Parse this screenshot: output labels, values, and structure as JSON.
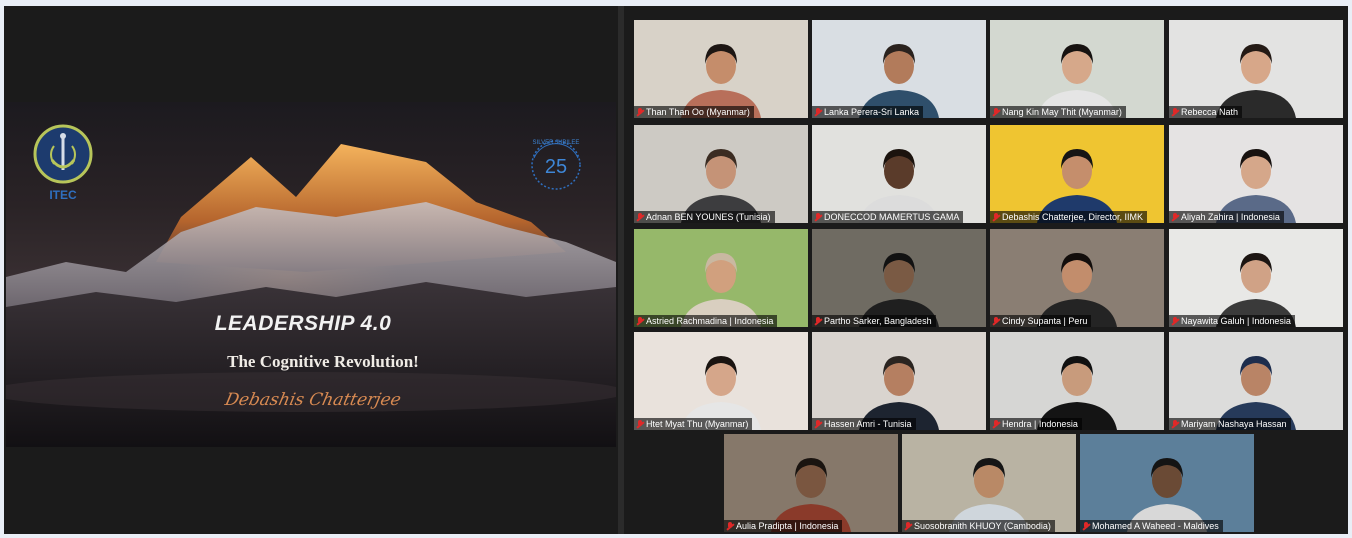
{
  "shared_screen": {
    "logo_left_text": "ITEC",
    "logo_right_number": "25",
    "logo_right_arc_text": "SILVER JUBILEE",
    "title": "LEADERSHIP 4.0",
    "subtitle": "The Cognitive Revolution!",
    "signature": "Debashis Chatterjee"
  },
  "participants": [
    {
      "name": "Than Than Oo (Myanmar)",
      "bg": "#d8d2c8",
      "shirt": "#b86f5a",
      "skin": "#c58d6b",
      "hair": "#1d1613"
    },
    {
      "name": "Lanka Perera-Sri Lanka",
      "bg": "#d9dee3",
      "shirt": "#2f4f6b",
      "skin": "#b27b5b",
      "hair": "#2a221e"
    },
    {
      "name": "Nang Kin May Thit (Myanmar)",
      "bg": "#d3d8d0",
      "shirt": "#e5e5e5",
      "skin": "#d6a88a",
      "hair": "#161210"
    },
    {
      "name": "Rebecca Nath",
      "bg": "#e3e3e2",
      "shirt": "#2a2a2a",
      "skin": "#d7a789",
      "hair": "#241a15"
    },
    {
      "name": "Adnan BEN YOUNES (Tunisia)",
      "bg": "#cdcac4",
      "shirt": "#3d3d3f",
      "skin": "#c59377",
      "hair": "#3b2c22"
    },
    {
      "name": "DONECCOD MAMERTUS GAMA",
      "bg": "#e1e1de",
      "shirt": "#dcdcdc",
      "skin": "#5a3b2a",
      "hair": "#1b130e"
    },
    {
      "name": "Debashis Chatterjee, Director, IIMK",
      "bg": "#efc531",
      "shirt": "#1f3a6b",
      "skin": "#c58e6c",
      "hair": "#151515"
    },
    {
      "name": "Aliyah Zahira | Indonesia",
      "bg": "#e5e3e3",
      "shirt": "#5a6a88",
      "skin": "#d5a78a",
      "hair": "#181210"
    },
    {
      "name": "Astried Rachmadina | Indonesia",
      "bg": "#96b86a",
      "shirt": "#d9cfc0",
      "skin": "#d1a07e",
      "hair": "#c9b8a1"
    },
    {
      "name": "Partho Sarker, Bangladesh",
      "bg": "#6f6b62",
      "shirt": "#1f1f1f",
      "skin": "#7a5a44",
      "hair": "#121212"
    },
    {
      "name": "Cindy Supanta | Peru",
      "bg": "#8a7e73",
      "shirt": "#242424",
      "skin": "#c28d6c",
      "hair": "#120d0b"
    },
    {
      "name": "Nayawita Galuh | Indonesia",
      "bg": "#e8e8e6",
      "shirt": "#3a3a3a",
      "skin": "#d0a286",
      "hair": "#1c1512"
    },
    {
      "name": "Htet Myat Thu (Myanmar)",
      "bg": "#e9e2dc",
      "shirt": "#e6e6e6",
      "skin": "#d5a68a",
      "hair": "#1a1411"
    },
    {
      "name": "Hassen Amri - Tunisia",
      "bg": "#d9d4cf",
      "shirt": "#1d2430",
      "skin": "#b57f61",
      "hair": "#2a2420"
    },
    {
      "name": "Hendra | Indonesia",
      "bg": "#d6d6d4",
      "shirt": "#141414",
      "skin": "#c89b7c",
      "hair": "#111111"
    },
    {
      "name": "Mariyam Nashaya Hassan",
      "bg": "#dcdcdb",
      "shirt": "#263a5a",
      "skin": "#b98466",
      "hair": "#1d2d4d"
    },
    {
      "name": "Aulia Pradipta | Indonesia",
      "bg": "#86786a",
      "shirt": "#8a3a2a",
      "skin": "#7a5640",
      "hair": "#1a1410"
    },
    {
      "name": "Suosobranith KHUOY (Cambodia)",
      "bg": "#b9b3a3",
      "shirt": "#cfd6dc",
      "skin": "#b98966",
      "hair": "#151515"
    },
    {
      "name": "Mohamed A Waheed - Maldives",
      "bg": "#5c7f9a",
      "shirt": "#d8d8d8",
      "skin": "#6a4a35",
      "hair": "#141414"
    }
  ]
}
